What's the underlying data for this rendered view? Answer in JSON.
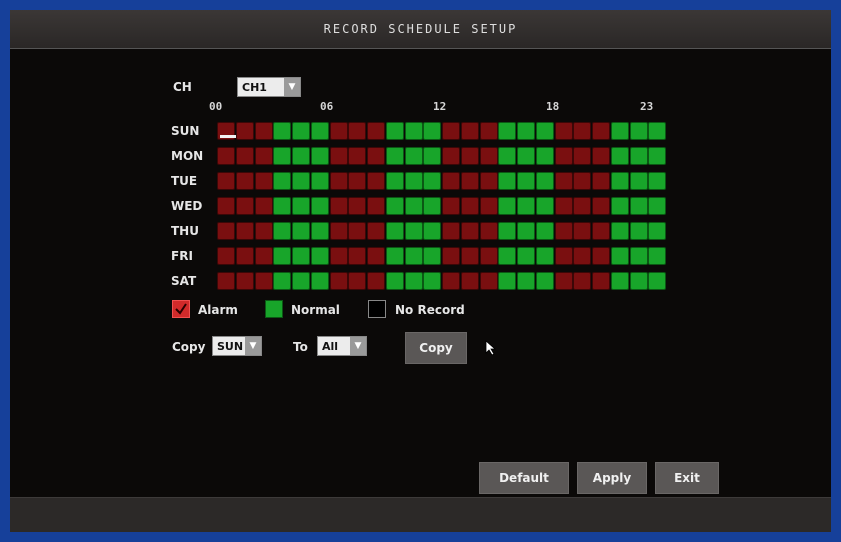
{
  "window": {
    "title": "RECORD SCHEDULE SETUP"
  },
  "channel": {
    "label": "CH",
    "selected": "CH1"
  },
  "hours": [
    "00",
    "06",
    "12",
    "18",
    "23"
  ],
  "days": [
    "SUN",
    "MON",
    "TUE",
    "WED",
    "THU",
    "FRI",
    "SAT"
  ],
  "schedule_pattern": [
    "alarm",
    "alarm",
    "alarm",
    "normal",
    "normal",
    "normal",
    "alarm",
    "alarm",
    "alarm",
    "normal",
    "normal",
    "normal",
    "alarm",
    "alarm",
    "alarm",
    "normal",
    "normal",
    "normal",
    "alarm",
    "alarm",
    "alarm",
    "normal",
    "normal",
    "normal"
  ],
  "legend": {
    "alarm": "Alarm",
    "normal": "Normal",
    "none": "No Record"
  },
  "colors": {
    "alarm": "#7a0f10",
    "normal": "#18a52a",
    "none": "#000000",
    "checked_alarm": "#d12a2a"
  },
  "copy": {
    "label": "Copy",
    "from": "SUN",
    "to_label": "To",
    "to": "All",
    "button": "Copy"
  },
  "buttons": {
    "default": "Default",
    "apply": "Apply",
    "exit": "Exit"
  }
}
